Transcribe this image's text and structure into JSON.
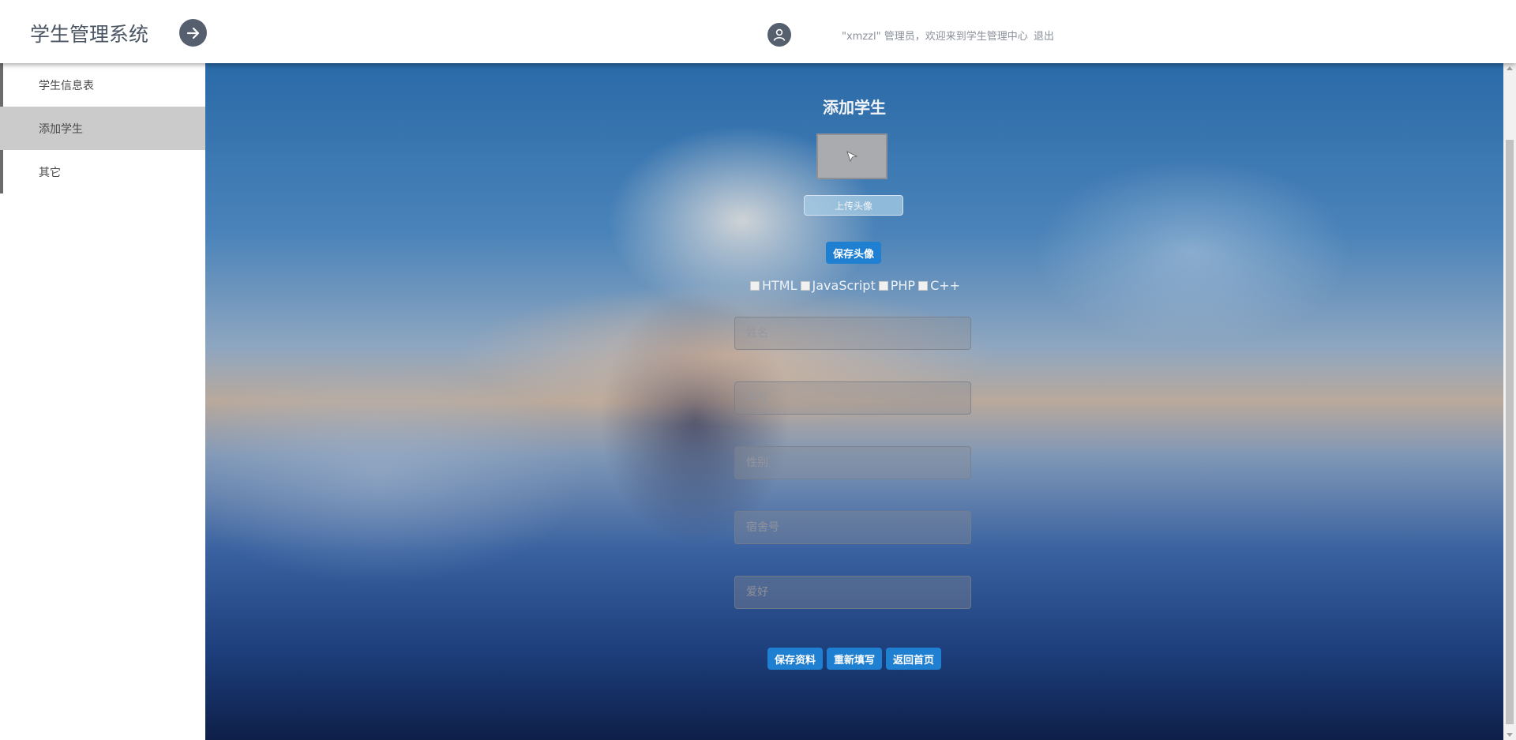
{
  "header": {
    "app_title": "学生管理系统",
    "nav_icon": "arrow-right-icon",
    "user_icon": "user-icon",
    "welcome": "\"xmzzl\" 管理员，欢迎来到学生管理中心",
    "logout": "退出"
  },
  "sidebar": {
    "items": [
      {
        "label": "学生信息表"
      },
      {
        "label": "添加学生"
      },
      {
        "label": "其它"
      }
    ],
    "active_index": 1
  },
  "form": {
    "title": "添加学生",
    "upload_avatar": "上传头像",
    "save_avatar": "保存头像",
    "hobbies": [
      {
        "label": "HTML"
      },
      {
        "label": "JavaScript"
      },
      {
        "label": "PHP"
      },
      {
        "label": "C++"
      }
    ],
    "fields": {
      "name_placeholder": "姓名",
      "student_id_placeholder": "学号",
      "gender_placeholder": "性别",
      "dorm_placeholder": "宿舍号",
      "hobby_placeholder": "爱好"
    },
    "buttons": {
      "save": "保存资料",
      "reset": "重新填写",
      "home": "返回首页"
    }
  },
  "colors": {
    "header_bg": "#ffffff",
    "accent_blue": "#1f7fd1",
    "sidebar_active": "#cbcbcb",
    "icon_dark": "#565f6e"
  }
}
